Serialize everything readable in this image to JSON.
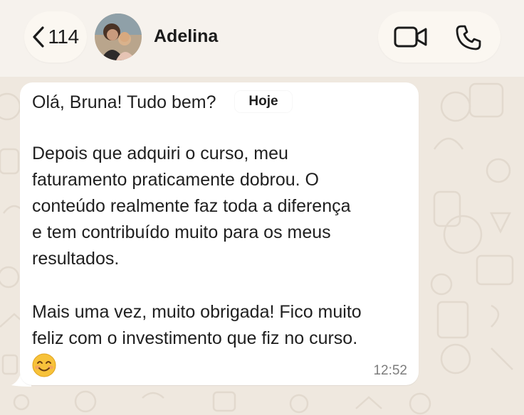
{
  "header": {
    "back_count": "114",
    "contact_name": "Adelina"
  },
  "icons": {
    "back": "chevron-left-icon",
    "video": "video-camera-icon",
    "phone": "phone-icon",
    "emoji": "smiling-face-emoji"
  },
  "colors": {
    "wallpaper": "#efe8df",
    "header_bg": "#f6f2ed",
    "bubble": "#ffffff",
    "text": "#1f1f1f",
    "timestamp": "#7d7d7d"
  },
  "message": {
    "date_chip": "Hoje",
    "lines": [
      "Olá, Bruna! Tudo bem?",
      "Depois que adquiri o curso, meu",
      "faturamento praticamente dobrou. O",
      "conteúdo realmente faz toda a diferença",
      "e tem contribuído muito para os meus",
      "resultados.",
      "Mais uma vez, muito obrigada! Fico muito",
      "feliz com o investimento que fiz no curso."
    ],
    "emoji": "😊",
    "time": "12:52"
  }
}
